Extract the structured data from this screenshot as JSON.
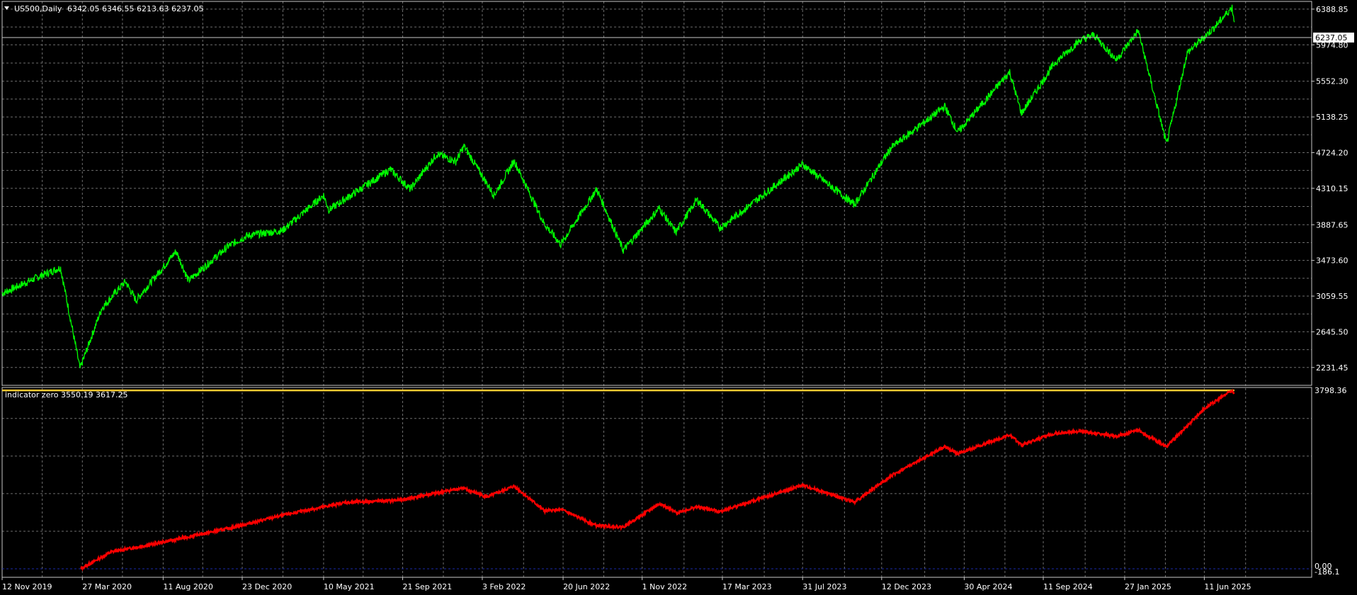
{
  "window": {
    "symbol_label": "US500,Daily",
    "ohlc_label": "6342.05 6346.55 6213.63 6237.05",
    "current_price_label": "6237.05"
  },
  "indicator": {
    "label": "indicator zero 3550.19 3617.25"
  },
  "colors": {
    "background": "#000000",
    "grid": "#6e6e6e",
    "frame": "#c8c8c8",
    "text": "#ffffff",
    "price_line": "#00ff00",
    "indicator_line": "#ff0000",
    "indicator_level": "#ffcc33",
    "zero_line": "#1a2aa8"
  },
  "chart_data": [
    {
      "type": "line",
      "title": "US500,Daily",
      "series": [
        {
          "name": "US500",
          "x": [
            "2019-11-12",
            "2020-01-15",
            "2020-02-19",
            "2020-03-23",
            "2020-04-29",
            "2020-06-08",
            "2020-06-26",
            "2020-09-02",
            "2020-09-23",
            "2020-11-30",
            "2020-12-31",
            "2021-03-01",
            "2021-05-10",
            "2021-05-19",
            "2021-08-31",
            "2021-10-04",
            "2021-11-18",
            "2021-12-20",
            "2022-01-03",
            "2022-02-23",
            "2022-03-29",
            "2022-05-19",
            "2022-06-16",
            "2022-08-16",
            "2022-09-30",
            "2022-11-30",
            "2022-12-28",
            "2023-02-02",
            "2023-03-13",
            "2023-05-15",
            "2023-07-31",
            "2023-10-27",
            "2023-12-28",
            "2024-03-28",
            "2024-04-19",
            "2024-07-16",
            "2024-08-05",
            "2024-09-30",
            "2024-11-11",
            "2024-12-06",
            "2025-01-13",
            "2025-02-19",
            "2025-04-08",
            "2025-05-13",
            "2025-06-27",
            "2025-07-28",
            "2025-08-01"
          ],
          "y": [
            3090,
            3290,
            3390,
            2220,
            2920,
            3230,
            3010,
            3580,
            3240,
            3640,
            3760,
            3820,
            4230,
            4060,
            4530,
            4300,
            4710,
            4620,
            4800,
            4230,
            4630,
            3900,
            3660,
            4300,
            3590,
            4080,
            3800,
            4180,
            3850,
            4180,
            4590,
            4120,
            4780,
            5260,
            4960,
            5660,
            5180,
            5760,
            6020,
            6090,
            5800,
            6140,
            4820,
            5880,
            6170,
            6410,
            6237.05
          ]
        }
      ],
      "ylim": [
        2024.4,
        6478.2
      ],
      "yticks": [
        "6388.85",
        "5974.80",
        "5552.30",
        "5138.25",
        "4724.20",
        "4310.15",
        "3887.65",
        "3473.60",
        "3059.55",
        "2645.50",
        "2231.45"
      ],
      "xticks": [
        "12 Nov 2019",
        "27 Mar 2020",
        "11 Aug 2020",
        "23 Dec 2020",
        "10 May 2021",
        "21 Sep 2021",
        "3 Feb 2022",
        "20 Jun 2022",
        "1 Nov 2022",
        "17 Mar 2023",
        "31 Jul 2023",
        "12 Dec 2023",
        "30 Apr 2024",
        "11 Sep 2024",
        "27 Jan 2025",
        "11 Jun 2025"
      ],
      "grid": true
    },
    {
      "type": "line",
      "title": "indicator zero 3550.19 3617.25",
      "series": [
        {
          "x": [
            "2020-03-24",
            "2020-05-15",
            "2020-07-31",
            "2020-11-30",
            "2021-03-01",
            "2021-06-15",
            "2021-09-15",
            "2021-12-31",
            "2022-02-11",
            "2022-03-29",
            "2022-05-20",
            "2022-06-17",
            "2022-08-16",
            "2022-09-30",
            "2022-12-01",
            "2022-12-29",
            "2023-02-02",
            "2023-03-13",
            "2023-07-31",
            "2023-10-27",
            "2023-12-28",
            "2024-03-28",
            "2024-04-19",
            "2024-07-16",
            "2024-08-05",
            "2024-09-30",
            "2024-11-11",
            "2025-01-13",
            "2025-02-19",
            "2025-04-08",
            "2025-06-10",
            "2025-07-28",
            "2025-08-01"
          ],
          "y": [
            0,
            360,
            540,
            860,
            1140,
            1410,
            1460,
            1720,
            1530,
            1760,
            1230,
            1260,
            920,
            890,
            1390,
            1190,
            1320,
            1220,
            1780,
            1420,
            1980,
            2600,
            2450,
            2850,
            2640,
            2880,
            2930,
            2820,
            2950,
            2600,
            3400,
            3800,
            3730
          ]
        }
      ],
      "ylim": [
        -180,
        3860
      ],
      "yticks": [
        "3798.36",
        "0.00",
        "-186.1"
      ],
      "levels": [
        3798.36,
        0
      ],
      "grid": true
    }
  ]
}
